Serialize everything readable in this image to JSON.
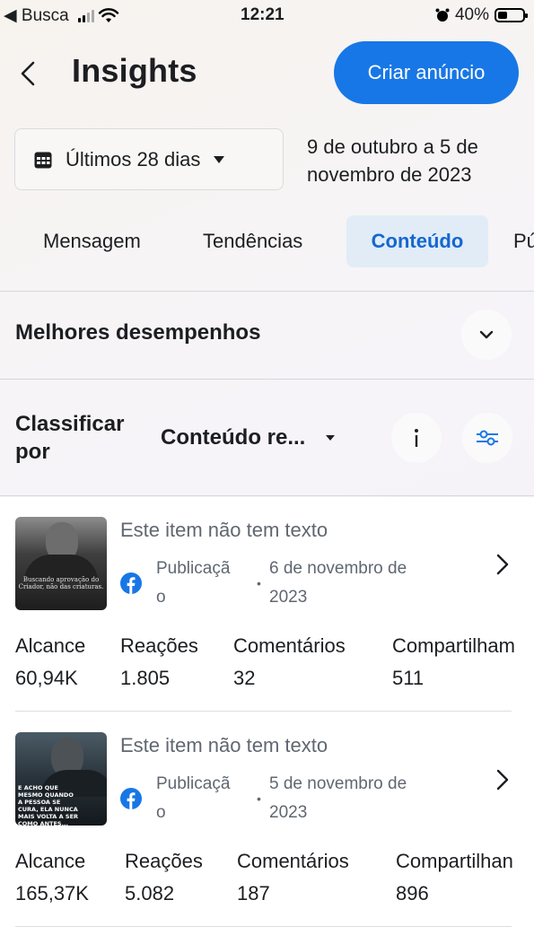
{
  "status_bar": {
    "back_app": "◀ Busca",
    "time": "12:21",
    "battery_text": "40%",
    "battery_level": 0.4
  },
  "header": {
    "title": "Insights",
    "create_ad_label": "Criar anúncio",
    "accent_color": "#1877e6"
  },
  "date_filter": {
    "selected": "Últimos 28 dias",
    "range_text_line1": "9 de outubro a 5 de",
    "range_text_line2": "novembro de 2023"
  },
  "tabs": [
    {
      "label": "Mensagem",
      "active": false
    },
    {
      "label": "Tendências",
      "active": false
    },
    {
      "label": "Conteúdo",
      "active": true
    },
    {
      "label": "Pú",
      "active": false
    }
  ],
  "best_performers": {
    "title": "Melhores desempenhos"
  },
  "sort": {
    "label": "Classificar por",
    "value": "Conteúdo re..."
  },
  "posts": [
    {
      "text": "Este item não tem texto",
      "type_line1": "Publicaçã",
      "type_line2": "o",
      "date_line1": "6 de novembro de",
      "date_line2": "2023",
      "thumb_caption": "Buscando aprovação do Criador, não das criaturas.",
      "metrics": {
        "reach_label": "Alcance",
        "reach": "60,94K",
        "reactions_label": "Reações",
        "reactions": "1.805",
        "comments_label": "Comentários",
        "comments": "32",
        "shares_label": "Compartilham",
        "shares": "511"
      }
    },
    {
      "text": "Este item não tem texto",
      "type_line1": "Publicaçã",
      "type_line2": "o",
      "date_line1": "5 de novembro de",
      "date_line2": "2023",
      "thumb_caption": "E ACHO QUE MESMO QUANDO A PESSOA SE CURA, ELA NUNCA MAIS VOLTA A SER COMO ANTES...",
      "metrics": {
        "reach_label": "Alcance",
        "reach": "165,37K",
        "reactions_label": "Reações",
        "reactions": "5.082",
        "comments_label": "Comentários",
        "comments": "187",
        "shares_label": "Compartilhan",
        "shares": "896"
      }
    }
  ]
}
